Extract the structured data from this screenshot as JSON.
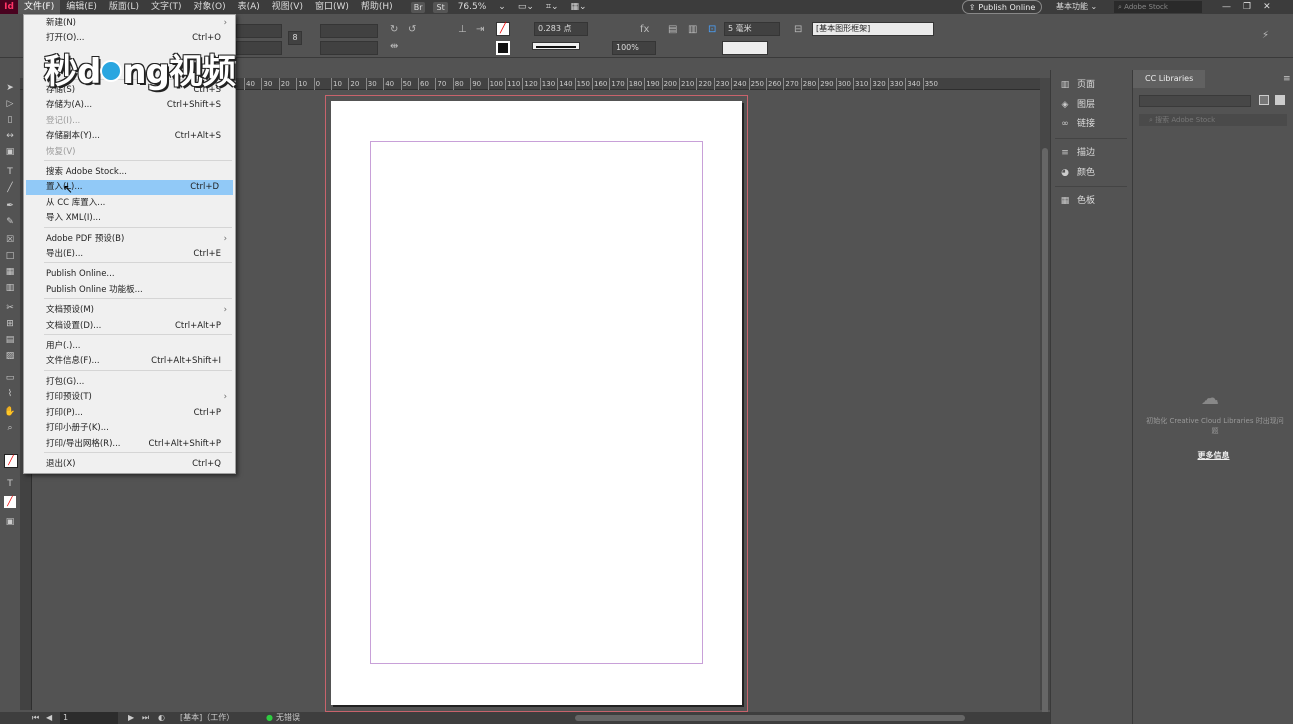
{
  "menubar": {
    "app_logo": "Id",
    "menus": [
      "文件(F)",
      "编辑(E)",
      "版面(L)",
      "文字(T)",
      "对象(O)",
      "表(A)",
      "视图(V)",
      "窗口(W)",
      "帮助(H)"
    ],
    "br_badge": "Br",
    "st_badge": "St",
    "zoom": "76.5%",
    "publish_online": "Publish Online",
    "workspace": "基本功能",
    "stock_search_placeholder": "Adobe Stock",
    "win_controls": [
      "—",
      "❐",
      "✕"
    ]
  },
  "control_bar": {
    "stroke_weight": "0.283 点",
    "opacity": "100%",
    "column_gap": "5 毫米",
    "object_style": "[基本图形框架]",
    "ref_field": "8"
  },
  "ruler_ticks": [
    "40",
    "30",
    "20",
    "10",
    "0",
    "10",
    "20",
    "30",
    "40",
    "50",
    "60",
    "70",
    "80",
    "90",
    "100",
    "110",
    "120",
    "130",
    "140",
    "150",
    "160",
    "170",
    "180",
    "190",
    "200",
    "210",
    "220",
    "230",
    "240",
    "250",
    "260",
    "270",
    "280",
    "290",
    "300",
    "310",
    "320",
    "330",
    "340",
    "350"
  ],
  "file_menu": {
    "items": [
      {
        "label": "新建(N)",
        "shortcut": "",
        "arrow": true,
        "disabled": false
      },
      {
        "label": "打开(O)...",
        "shortcut": "Ctrl+O",
        "arrow": false,
        "disabled": false
      },
      {
        "label": "存储(S)",
        "shortcut": "Ctrl+S",
        "arrow": false,
        "disabled": false
      },
      {
        "label": "存储为(A)...",
        "shortcut": "Ctrl+Shift+S",
        "arrow": false,
        "disabled": false
      },
      {
        "label": "登记(I)...",
        "shortcut": "",
        "arrow": false,
        "disabled": true
      },
      {
        "label": "存储副本(Y)...",
        "shortcut": "Ctrl+Alt+S",
        "arrow": false,
        "disabled": false
      },
      {
        "label": "恢复(V)",
        "shortcut": "",
        "arrow": false,
        "disabled": true
      },
      {
        "label": "搜索 Adobe Stock...",
        "shortcut": "",
        "arrow": false,
        "disabled": false
      },
      {
        "label": "置入(L)...",
        "shortcut": "Ctrl+D",
        "arrow": false,
        "disabled": false,
        "highlighted": true
      },
      {
        "label": "从 CC 库置入...",
        "shortcut": "",
        "arrow": false,
        "disabled": false
      },
      {
        "label": "导入 XML(I)...",
        "shortcut": "",
        "arrow": false,
        "disabled": false
      },
      {
        "label": "Adobe PDF 预设(B)",
        "shortcut": "",
        "arrow": true,
        "disabled": false
      },
      {
        "label": "导出(E)...",
        "shortcut": "Ctrl+E",
        "arrow": false,
        "disabled": false
      },
      {
        "label": "Publish Online...",
        "shortcut": "",
        "arrow": false,
        "disabled": false
      },
      {
        "label": "Publish Online 功能板...",
        "shortcut": "",
        "arrow": false,
        "disabled": false
      },
      {
        "label": "文档预设(M)",
        "shortcut": "",
        "arrow": true,
        "disabled": false
      },
      {
        "label": "文档设置(D)...",
        "shortcut": "Ctrl+Alt+P",
        "arrow": false,
        "disabled": false
      },
      {
        "label": "用户(.)...",
        "shortcut": "",
        "arrow": false,
        "disabled": false
      },
      {
        "label": "文件信息(F)...",
        "shortcut": "Ctrl+Alt+Shift+I",
        "arrow": false,
        "disabled": false
      },
      {
        "label": "打包(G)...",
        "shortcut": "",
        "arrow": false,
        "disabled": false
      },
      {
        "label": "打印预设(T)",
        "shortcut": "",
        "arrow": true,
        "disabled": false
      },
      {
        "label": "打印(P)...",
        "shortcut": "Ctrl+P",
        "arrow": false,
        "disabled": false
      },
      {
        "label": "打印小册子(K)...",
        "shortcut": "",
        "arrow": false,
        "disabled": false
      },
      {
        "label": "打印/导出网格(R)...",
        "shortcut": "Ctrl+Alt+Shift+P",
        "arrow": false,
        "disabled": false
      },
      {
        "label": "退出(X)",
        "shortcut": "Ctrl+Q",
        "arrow": false,
        "disabled": false
      }
    ]
  },
  "watermark": {
    "text_a": "秒d",
    "text_b": "ng视频"
  },
  "panel_dock": {
    "items": [
      "页面",
      "图层",
      "链接",
      "描边",
      "颜色",
      "色板"
    ]
  },
  "cc_libraries": {
    "tab_label": "CC Libraries",
    "search_placeholder": "搜索 Adobe Stock",
    "message": "初始化 Creative Cloud Libraries 时出现问题",
    "more_info": "更多信息"
  },
  "status_bar": {
    "page_number": "1",
    "master": "[基本]（工作）",
    "preflight": "无错误"
  }
}
